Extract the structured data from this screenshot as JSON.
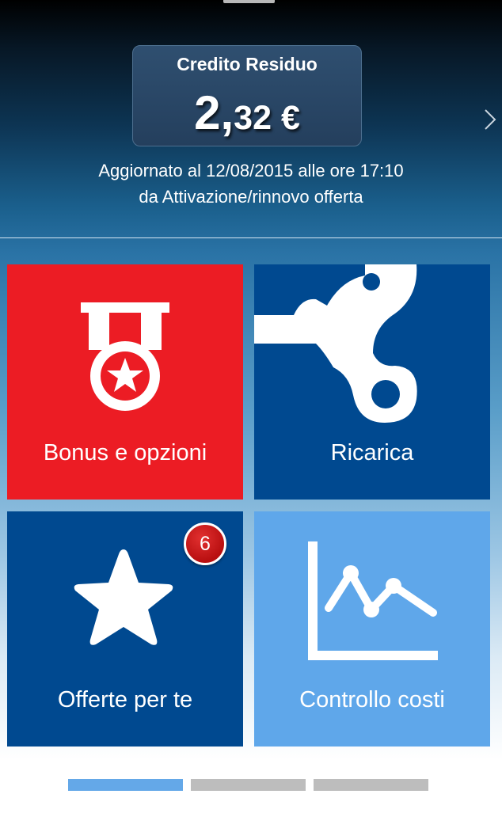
{
  "credit": {
    "title": "Credito Residuo",
    "amount_int": "2,",
    "amount_dec": "32 €"
  },
  "update": {
    "line1": "Aggiornato al 12/08/2015 alle ore 17:10",
    "line2": "da Attivazione/rinnovo offerta"
  },
  "tiles": [
    {
      "label": "Bonus e opzioni",
      "icon": "medal-icon",
      "color": "#ec1c24"
    },
    {
      "label": "Ricarica",
      "icon": "wind-up-key-icon",
      "color": "#004990"
    },
    {
      "label": "Offerte per te",
      "icon": "star-icon",
      "color": "#004990",
      "badge": "6"
    },
    {
      "label": "Controllo costi",
      "icon": "line-chart-icon",
      "color": "#5fa7ea"
    }
  ],
  "pagination": {
    "pages": 3,
    "active_index": 0,
    "active_color": "#64a8e8",
    "inactive_color": "#bdbdbd"
  }
}
